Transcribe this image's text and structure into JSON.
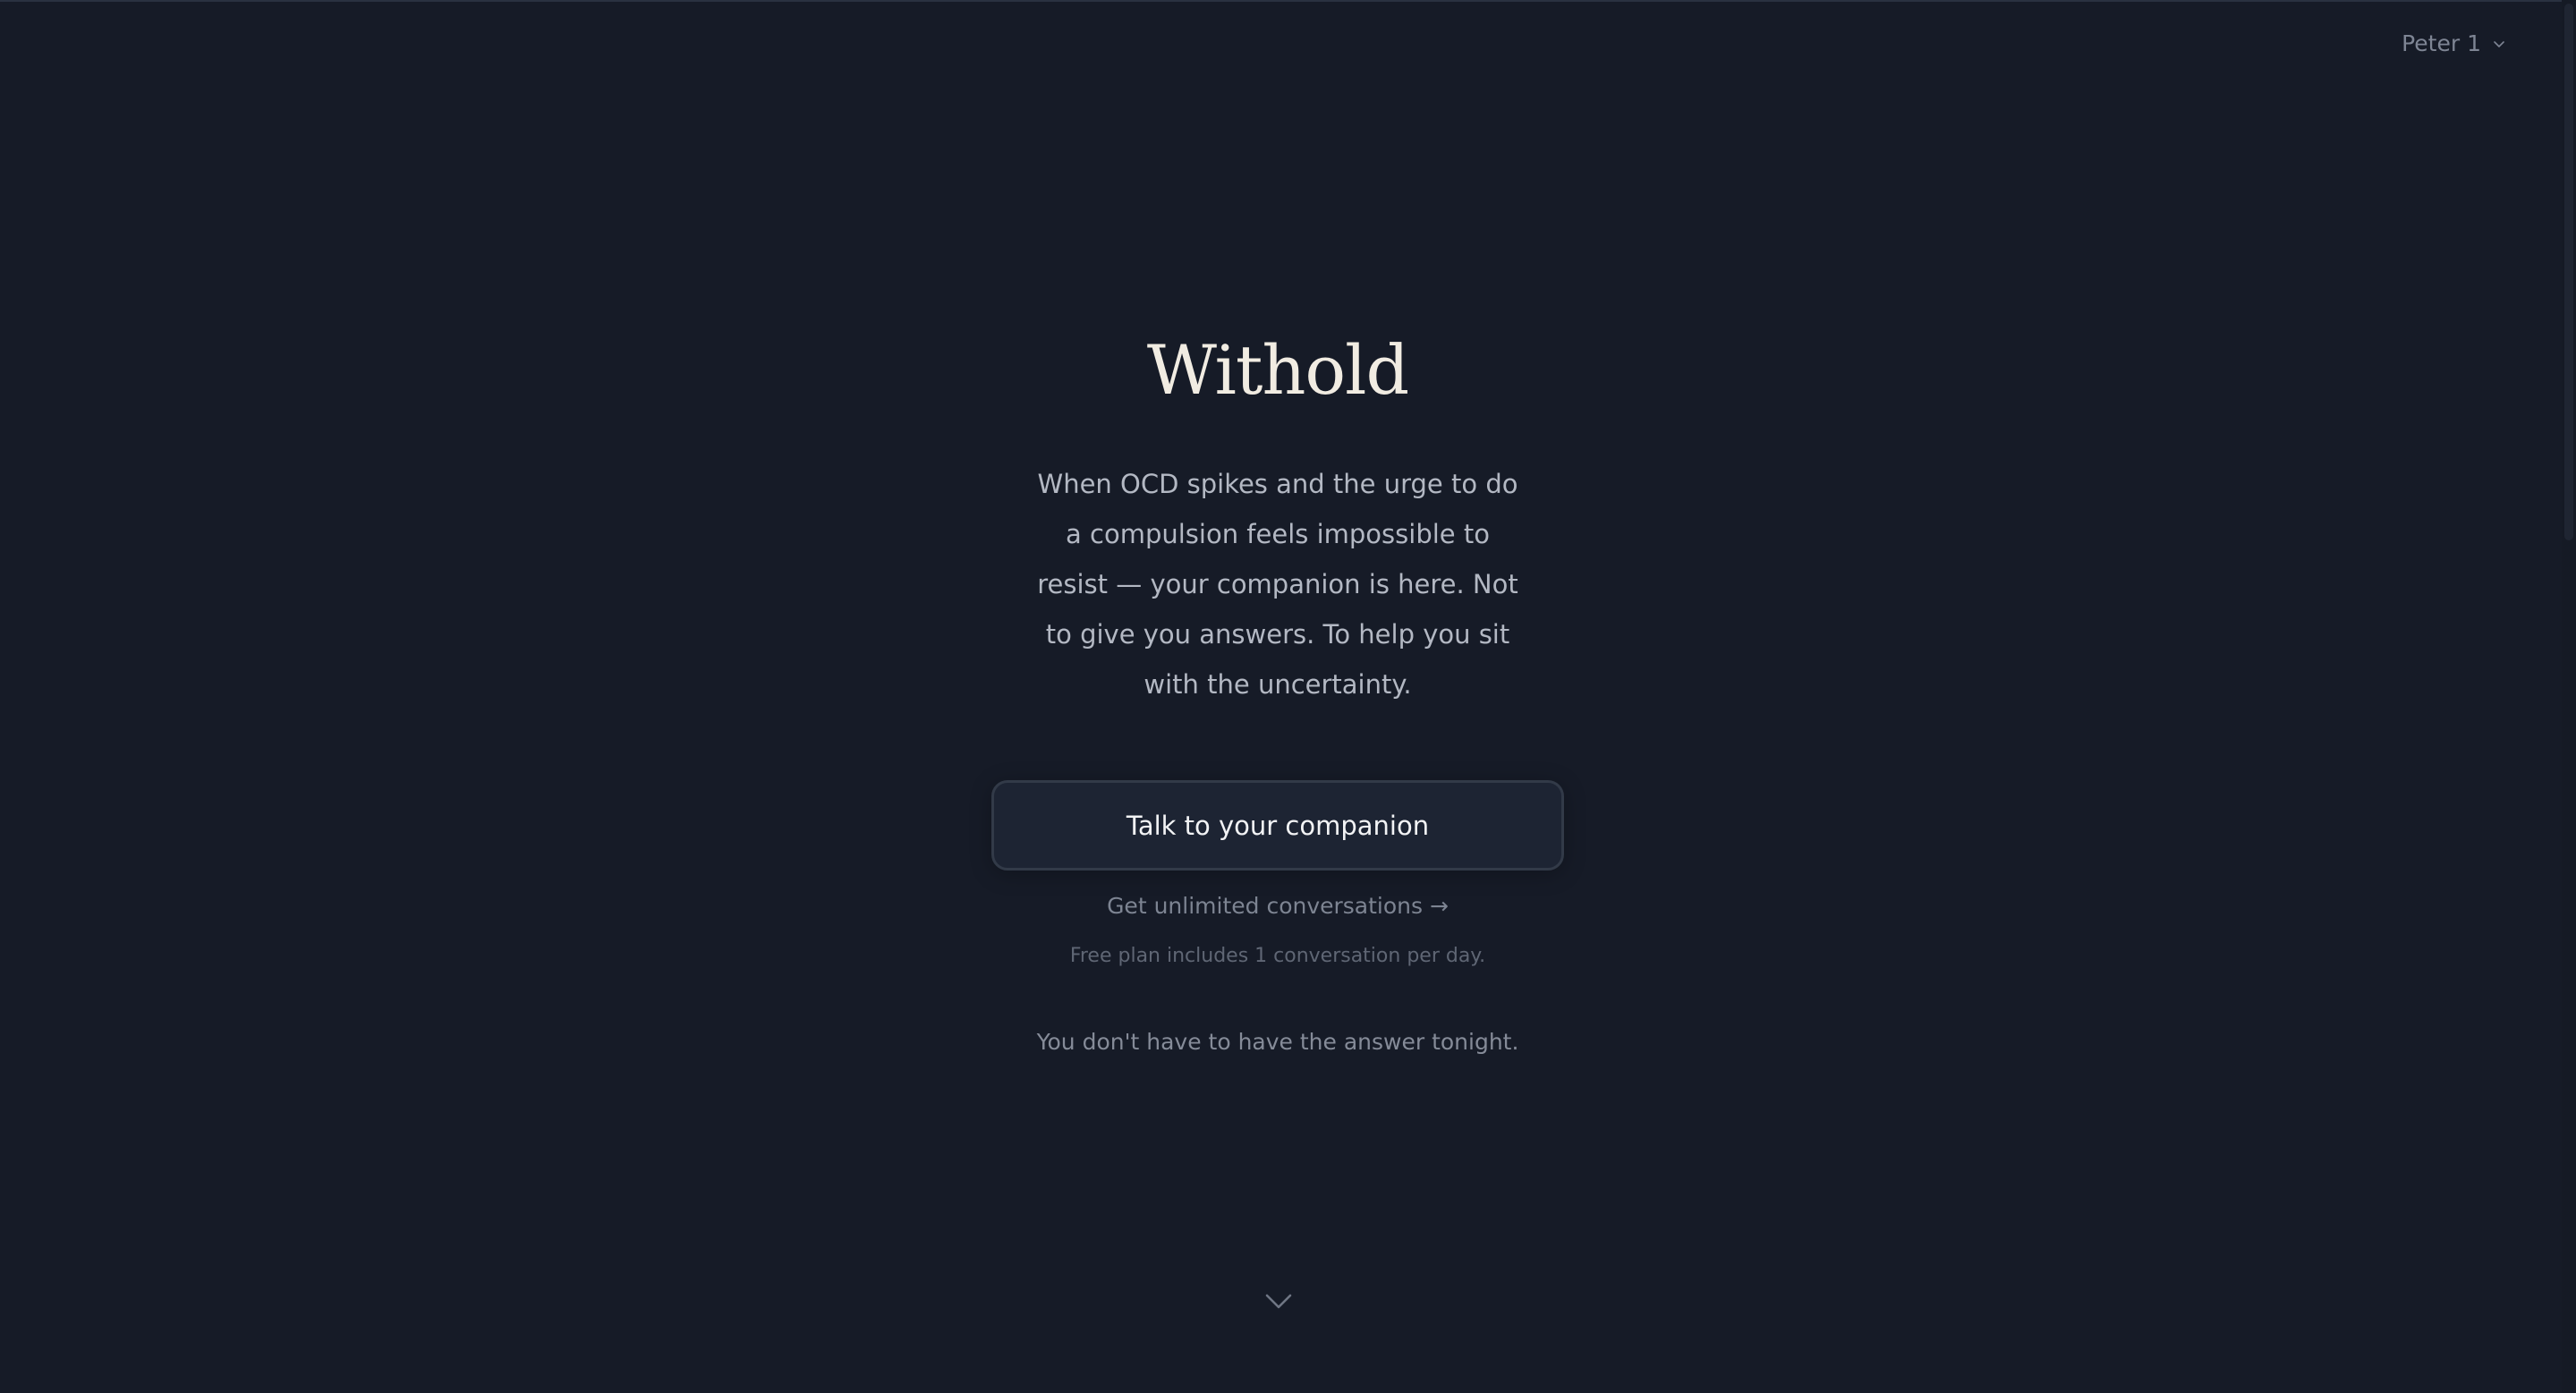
{
  "header": {
    "user_name": "Peter 1",
    "user_menu_icon": "chevron-down-icon"
  },
  "hero": {
    "title": "Withold",
    "description": "When OCD spikes and the urge to do a compulsion feels impossible to resist — your companion is here. Not to give you answers. To help you sit with the uncertainty.",
    "cta_label": "Talk to your companion",
    "upgrade_link": "Get unlimited conversations →",
    "free_note": "Free plan includes 1 conversation per day.",
    "tagline": "You don't have to have the answer tonight."
  },
  "scroll_hint": {
    "icon": "chevron-down-icon"
  },
  "colors": {
    "background": "#161b27",
    "title": "#f1ece2",
    "button_bg": "#1d2433",
    "button_border": "#323a48",
    "muted_text": "#7d8492"
  }
}
